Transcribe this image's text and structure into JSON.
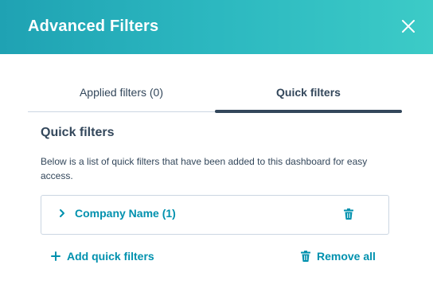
{
  "dialog": {
    "title": "Advanced Filters"
  },
  "tabs": [
    {
      "label": "Applied filters (0)",
      "active": false
    },
    {
      "label": "Quick filters",
      "active": true
    }
  ],
  "section": {
    "title": "Quick filters",
    "description": "Below is a list of quick filters that have been added to this dashboard for easy access."
  },
  "quick_filters": [
    {
      "label": "Company Name (1)"
    }
  ],
  "actions": {
    "add_label": "Add quick filters",
    "remove_all_label": "Remove all"
  },
  "icons": {
    "close": "close-icon",
    "expand": "chevron-right-icon",
    "delete": "trash-icon",
    "add": "plus-icon",
    "remove_all": "trash-icon"
  },
  "colors": {
    "header_gradient_start": "#1fa2b3",
    "header_gradient_end": "#3ccbc7",
    "text": "#33475b",
    "link": "#0091ae",
    "border": "#cbd6e2"
  }
}
